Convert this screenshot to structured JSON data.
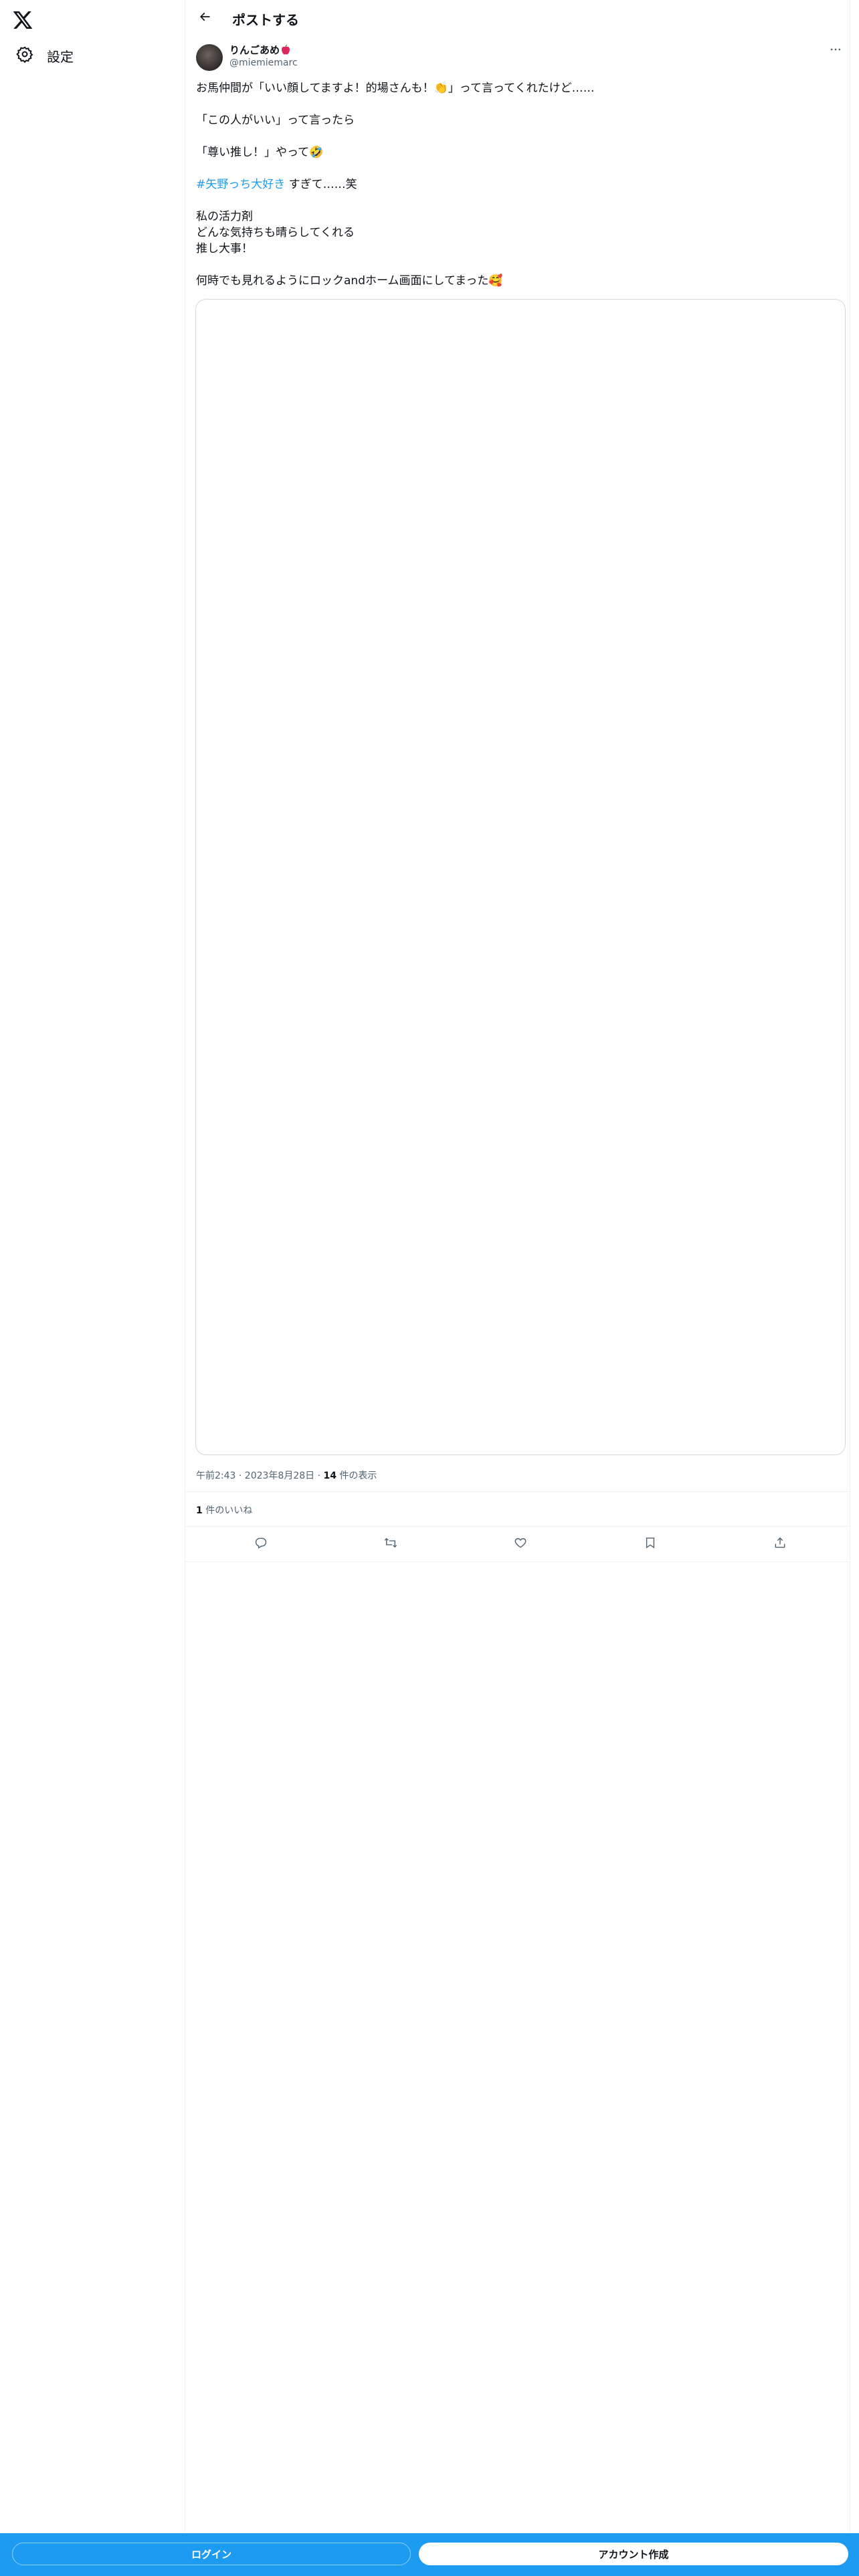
{
  "sidebar": {
    "logo": "x-logo-icon",
    "settings": {
      "icon": "gear-icon",
      "label": "設定"
    }
  },
  "header": {
    "back_icon": "arrow-left-icon",
    "title": "ポストする"
  },
  "post": {
    "author": {
      "name": "りんごあめ",
      "name_emoji": "red-apple-icon",
      "handle": "@miemiemarc"
    },
    "more_icon": "more-horizontal-icon",
    "lines": {
      "l1": "お馬仲間が「いい顔してますよ！的場さんも！👏」って言ってくれたけど……",
      "l2": "「この人がいい」って言ったら",
      "l3": "「尊い推し！」やって🤣",
      "hashtag": "#矢野っち大好き",
      "l4_rest": " すぎて……笑",
      "l5": "私の活力剤",
      "l6": "どんな気持ちも晴らしてくれる",
      "l7": "推し大事！",
      "l8": "何時でも見れるようにロックandホーム画面にしてまった🥰"
    },
    "timestamp": "午前2:43 · 2023年8月28日",
    "views_count": "14",
    "views_label": "件の表示",
    "likes_count": "1",
    "likes_label": "件のいいね"
  },
  "actions": {
    "reply": "reply-icon",
    "repost": "repost-icon",
    "like": "heart-icon",
    "bookmark": "bookmark-icon",
    "share": "share-icon"
  },
  "bottom_bar": {
    "login": "ログイン",
    "signup": "アカウント作成"
  },
  "colors": {
    "accent": "#1d9bf0",
    "text": "#0f1419",
    "secondary": "#536471",
    "border": "#eff3f4"
  }
}
